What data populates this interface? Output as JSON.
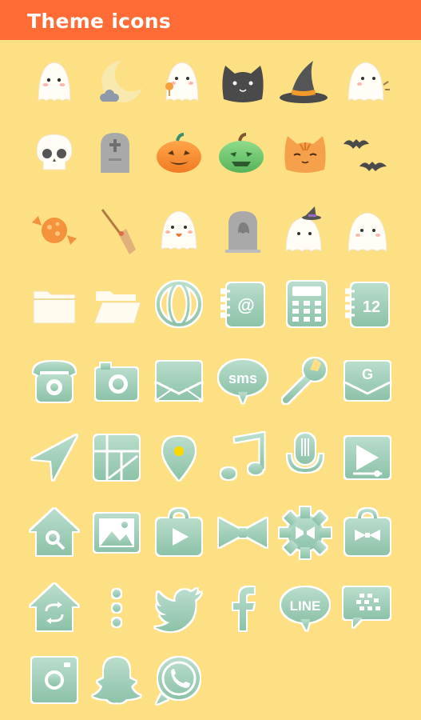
{
  "header": {
    "title": "Theme icons"
  },
  "icons": [
    {
      "name": "ghost-icon"
    },
    {
      "name": "moon-icon"
    },
    {
      "name": "ghost-lollipop-icon"
    },
    {
      "name": "black-cat-icon"
    },
    {
      "name": "witch-hat-icon"
    },
    {
      "name": "ghost-peek-icon"
    },
    {
      "name": "skull-icon"
    },
    {
      "name": "gravestone-cross-icon"
    },
    {
      "name": "orange-pumpkin-icon"
    },
    {
      "name": "green-pumpkin-icon"
    },
    {
      "name": "orange-cat-icon"
    },
    {
      "name": "bats-icon"
    },
    {
      "name": "candy-icon"
    },
    {
      "name": "broom-icon"
    },
    {
      "name": "ghost-tongue-icon"
    },
    {
      "name": "gravestone-ghost-icon"
    },
    {
      "name": "ghost-witch-hat-icon"
    },
    {
      "name": "ghost-plain-icon"
    },
    {
      "name": "folder-icon"
    },
    {
      "name": "folder-open-icon"
    },
    {
      "name": "globe-icon"
    },
    {
      "name": "contacts-icon"
    },
    {
      "name": "calculator-icon"
    },
    {
      "name": "calendar-icon"
    },
    {
      "name": "phone-icon"
    },
    {
      "name": "camera-icon"
    },
    {
      "name": "mail-icon"
    },
    {
      "name": "sms-icon"
    },
    {
      "name": "wrench-icon"
    },
    {
      "name": "gmail-icon"
    },
    {
      "name": "navigation-icon"
    },
    {
      "name": "maps-icon"
    },
    {
      "name": "location-pin-icon"
    },
    {
      "name": "music-icon"
    },
    {
      "name": "microphone-icon"
    },
    {
      "name": "play-store-icon"
    },
    {
      "name": "home-search-icon"
    },
    {
      "name": "gallery-icon"
    },
    {
      "name": "video-bag-icon"
    },
    {
      "name": "bowtie-icon"
    },
    {
      "name": "settings-gear-icon"
    },
    {
      "name": "bowtie-bag-icon"
    },
    {
      "name": "home-sync-icon"
    },
    {
      "name": "more-vertical-icon"
    },
    {
      "name": "twitter-icon"
    },
    {
      "name": "facebook-icon"
    },
    {
      "name": "line-icon"
    },
    {
      "name": "bbm-icon"
    },
    {
      "name": "instagram-icon"
    },
    {
      "name": "snapchat-icon"
    },
    {
      "name": "whatsapp-icon"
    }
  ],
  "labels": {
    "sms": "sms",
    "line": "LINE",
    "gmail": "G",
    "calendar": "12",
    "contacts": "@"
  },
  "colors": {
    "header": "#ff6b35",
    "background": "#fde084",
    "icon_green": "#9ccbb5",
    "icon_green_dark": "#7db89c"
  }
}
